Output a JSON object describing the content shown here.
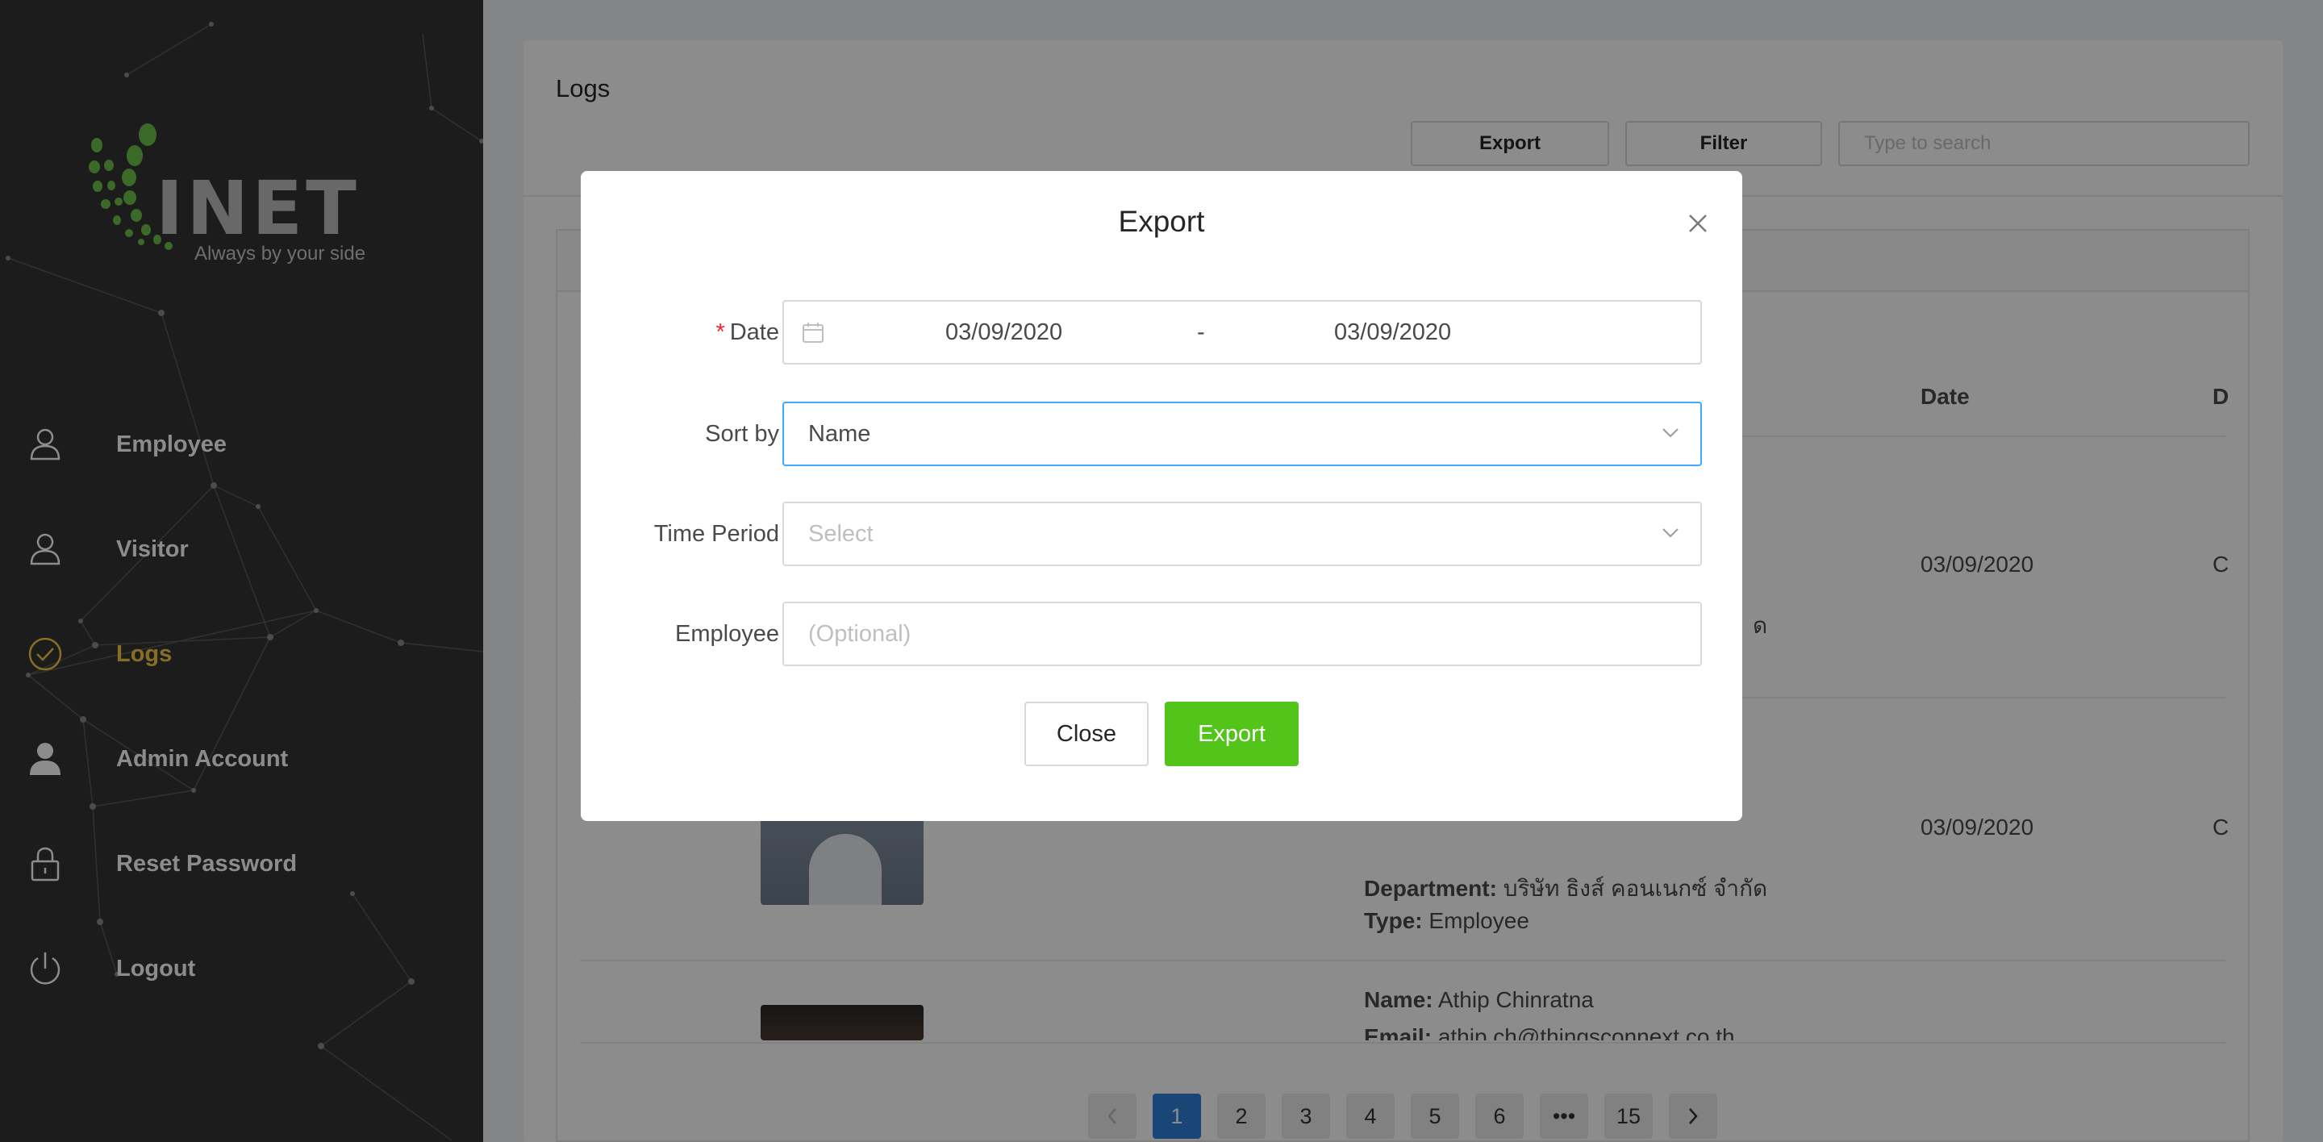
{
  "sidebar": {
    "logo": {
      "word": "INET",
      "tagline": "Always by your side"
    },
    "items": [
      {
        "label": "Employee",
        "icon": "user-outline-icon",
        "active": false
      },
      {
        "label": "Visitor",
        "icon": "user-outline-icon",
        "active": false
      },
      {
        "label": "Logs",
        "icon": "check-circle-icon",
        "active": true
      },
      {
        "label": "Admin Account",
        "icon": "user-filled-icon",
        "active": false
      },
      {
        "label": "Reset Password",
        "icon": "lock-icon",
        "active": false
      },
      {
        "label": "Logout",
        "icon": "power-icon",
        "active": false
      }
    ]
  },
  "main": {
    "title": "Logs",
    "toolbar": {
      "export_label": "Export",
      "filter_label": "Filter",
      "search_placeholder": "Type to search"
    },
    "table": {
      "columns": {
        "date": "Date",
        "d": "D"
      },
      "rows": [
        {
          "date": "03/09/2020",
          "d": "C",
          "dept_tail": "ด"
        },
        {
          "date": "03/09/2020",
          "d": "C",
          "department_label": "Department:",
          "department": "บริษัท ธิงส์ คอนเนกซ์ จำกัด",
          "type_label": "Type:",
          "type": "Employee"
        },
        {
          "name_label": "Name:",
          "name": "Athip Chinratna",
          "email_label": "Email:",
          "email": "athip.ch@thingsconnext.co.th"
        }
      ]
    },
    "pagination": {
      "pages": [
        "1",
        "2",
        "3",
        "4",
        "5",
        "6",
        "•••",
        "15"
      ],
      "current": "1"
    }
  },
  "modal": {
    "title": "Export",
    "date": {
      "label": "Date",
      "required": true,
      "start": "03/09/2020",
      "separator": "-",
      "end": "03/09/2020"
    },
    "sort_by": {
      "label": "Sort by",
      "value": "Name"
    },
    "time_period": {
      "label": "Time Period",
      "placeholder": "Select"
    },
    "employee": {
      "label": "Employee",
      "placeholder": "(Optional)"
    },
    "close_label": "Close",
    "export_label": "Export"
  },
  "colors": {
    "accent_yellow": "#f5c842",
    "primary_blue": "#2f7fd9",
    "success_green": "#52c41a",
    "sidebar_bg": "#333333",
    "logo_green": "#6cc24a"
  }
}
